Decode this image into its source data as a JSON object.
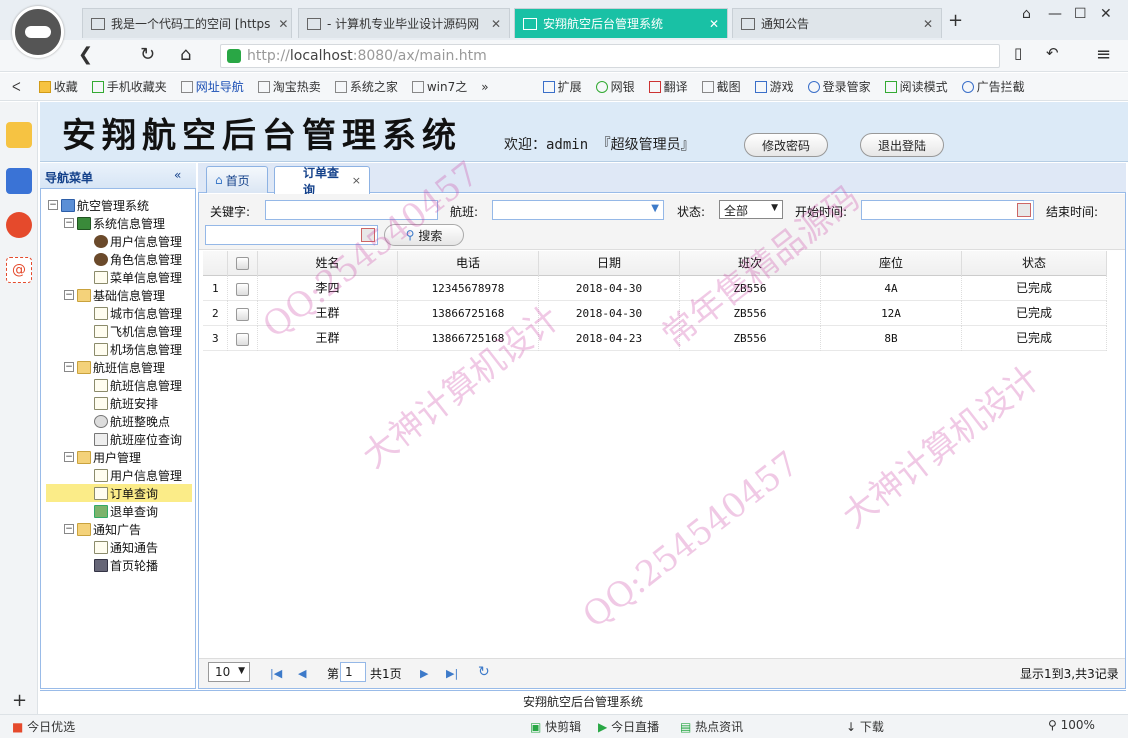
{
  "browser": {
    "tabs": [
      {
        "label": "我是一个代码工的空间 [https",
        "active": false
      },
      {
        "label": "- 计算机专业毕业设计源码网",
        "active": false
      },
      {
        "label": "安翔航空后台管理系统",
        "active": true
      },
      {
        "label": "通知公告",
        "active": false
      }
    ],
    "url_protocol": "http://",
    "url_host": "localhost",
    "url_path": ":8080/ax/main.htm",
    "bookmarks": [
      "收藏",
      "手机收藏夹",
      "网址导航",
      "淘宝热卖",
      "系统之家",
      "win7之"
    ],
    "right_tools": [
      "扩展",
      "网银",
      "翻译",
      "截图",
      "游戏",
      "登录管家",
      "阅读模式",
      "广告拦截"
    ],
    "status_left": "今日优选",
    "status_items": [
      "快剪辑",
      "今日直播",
      "热点资讯",
      "下载"
    ],
    "zoom": "100%"
  },
  "app": {
    "title": "安翔航空后台管理系统",
    "welcome": "欢迎：admin 『超级管理员』",
    "change_password": "修改密码",
    "logout": "退出登陆",
    "footer": "安翔航空后台管理系统"
  },
  "nav": {
    "header": "导航菜单",
    "collapse": "«",
    "root": "航空管理系统",
    "groups": [
      {
        "label": "系统信息管理",
        "items": [
          "用户信息管理",
          "角色信息管理",
          "菜单信息管理"
        ]
      },
      {
        "label": "基础信息管理",
        "items": [
          "城市信息管理",
          "飞机信息管理",
          "机场信息管理"
        ]
      },
      {
        "label": "航班信息管理",
        "items": [
          "航班信息管理",
          "航班安排",
          "航班整晚点",
          "航班座位查询"
        ]
      },
      {
        "label": "用户管理",
        "items": [
          "用户信息管理",
          "订单查询",
          "退单查询"
        ]
      },
      {
        "label": "通知广告",
        "items": [
          "通知通告",
          "首页轮播"
        ]
      }
    ]
  },
  "tabs": {
    "home": "首页",
    "current": "订单查询",
    "close": "×"
  },
  "filter": {
    "keyword_label": "关键字:",
    "flight_label": "航班:",
    "status_label": "状态:",
    "status_value": "全部",
    "start_label": "开始时间:",
    "end_label": "结束时间:",
    "search": "搜索"
  },
  "grid": {
    "columns": [
      "姓名",
      "电话",
      "日期",
      "班次",
      "座位",
      "状态"
    ],
    "rows": [
      {
        "num": "1",
        "name": "李四",
        "phone": "12345678978",
        "date": "2018-04-30",
        "flight": "ZB556",
        "seat": "4A",
        "status": "已完成"
      },
      {
        "num": "2",
        "name": "王群",
        "phone": "13866725168",
        "date": "2018-04-30",
        "flight": "ZB556",
        "seat": "12A",
        "status": "已完成"
      },
      {
        "num": "3",
        "name": "王群",
        "phone": "13866725168",
        "date": "2018-04-23",
        "flight": "ZB556",
        "seat": "8B",
        "status": "已完成"
      }
    ]
  },
  "pager": {
    "page_size": "10",
    "page_prefix": "第",
    "page_value": "1",
    "total_pages": "共1页",
    "summary": "显示1到3,共3记录"
  },
  "watermark": {
    "texts": [
      "QQ:254540457",
      "大神计算机设计",
      "常年售精品源码"
    ]
  }
}
